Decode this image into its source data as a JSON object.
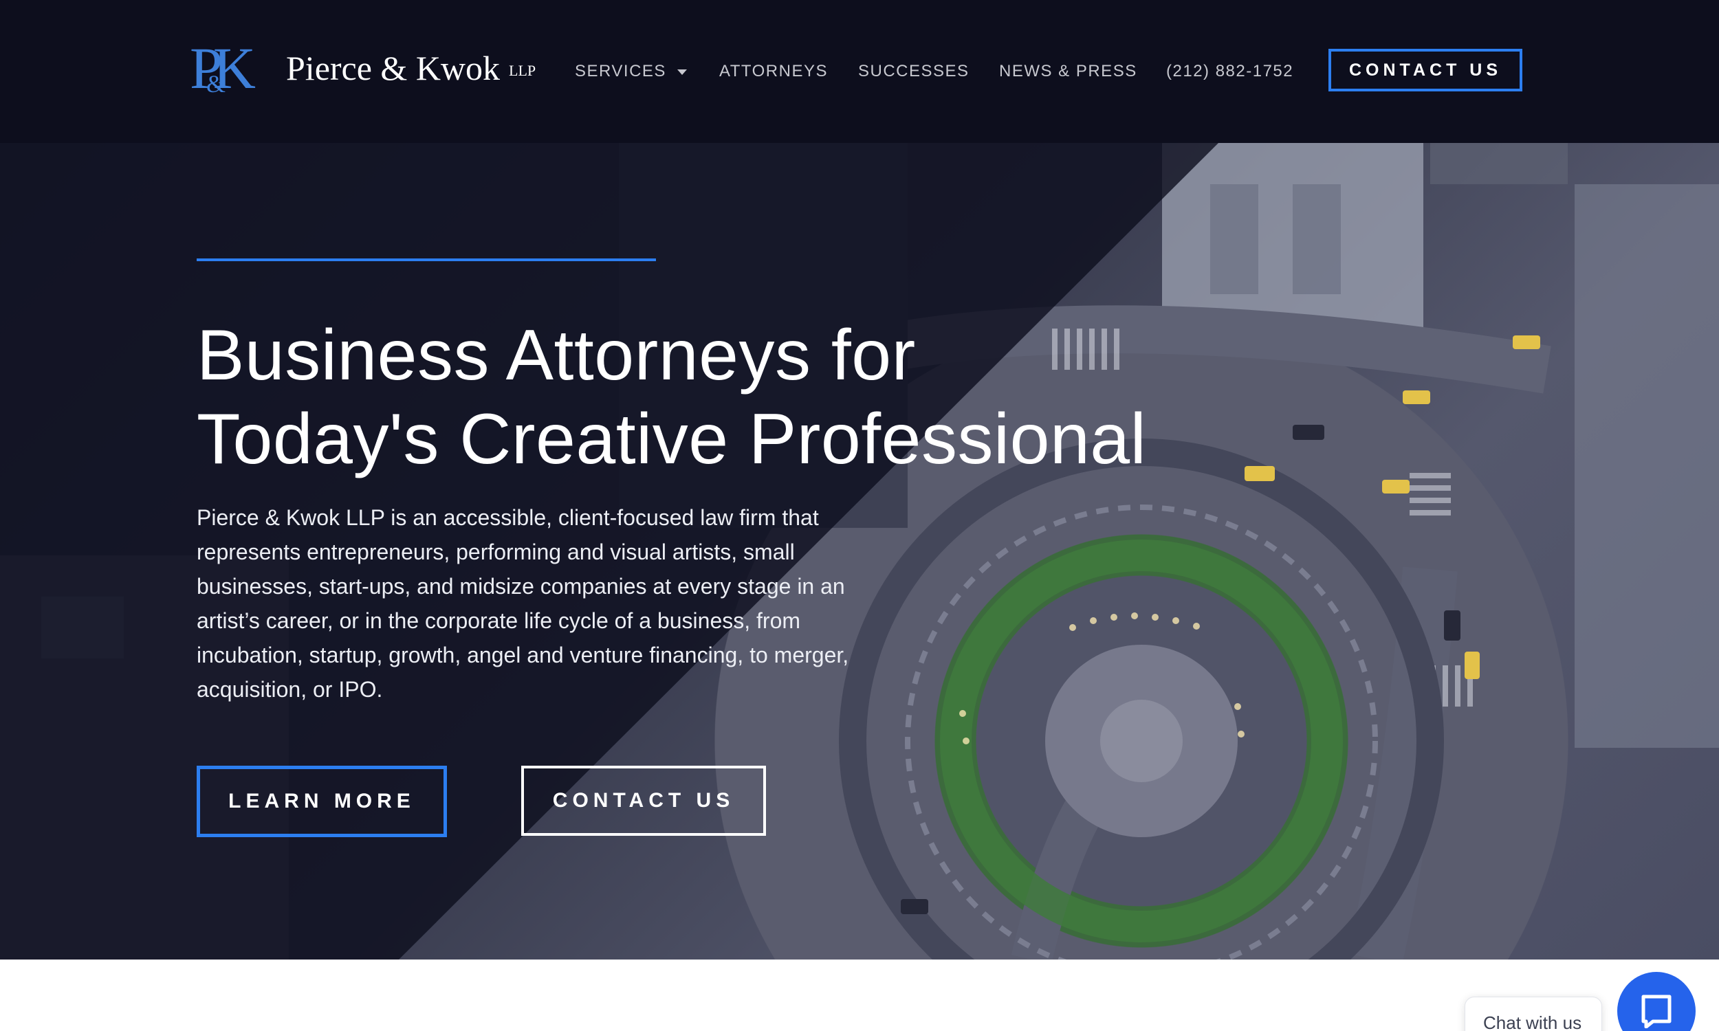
{
  "brand": {
    "mark": "PK",
    "mark_amp": "&",
    "name": "Pierce & Kwok",
    "suffix": "LLP"
  },
  "nav": {
    "items": [
      {
        "label": "SERVICES",
        "has_dropdown": true
      },
      {
        "label": "ATTORNEYS"
      },
      {
        "label": "SUCCESSES"
      },
      {
        "label": "NEWS & PRESS"
      },
      {
        "label": "(212) 882-1752"
      }
    ],
    "cta_label": "CONTACT US"
  },
  "hero": {
    "title_line1": "Business Attorneys for",
    "title_line2": "Today's Creative Professional",
    "body": "Pierce & Kwok LLP is an accessible, client-focused law firm that represents entrepreneurs, performing and visual artists, small businesses, start-ups, and midsize companies at every stage in an artist’s career, or in the corporate life cycle of a business, from incubation, startup, growth, angel and venture financing, to merger, acquisition, or IPO.",
    "learn_more_label": "LEARN MORE",
    "contact_label": "CONTACT US",
    "background_image": "aerial-city-traffic-circle"
  },
  "chat": {
    "label": "Chat with us",
    "icon": "chat-icon"
  },
  "colors": {
    "header_bg": "#0d0e1d",
    "accent": "#2c7ef0",
    "chat_button": "#2563eb",
    "text_light": "#ffffff"
  }
}
